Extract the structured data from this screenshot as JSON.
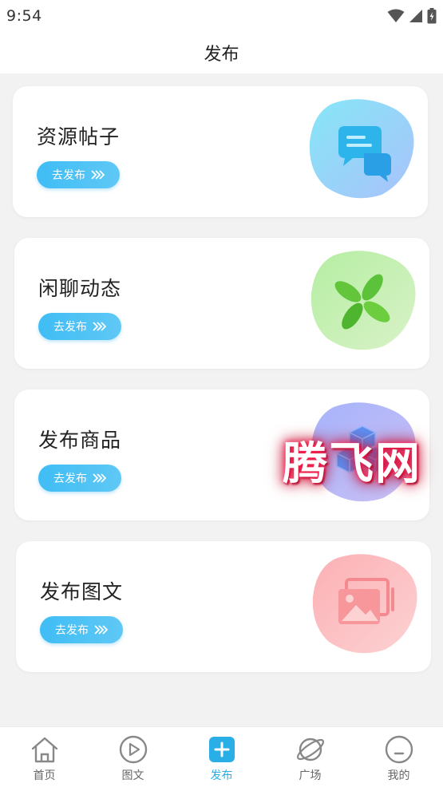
{
  "status": {
    "time": "9:54"
  },
  "header": {
    "title": "发布"
  },
  "cards": [
    {
      "title": "资源帖子",
      "button": "去发布",
      "icon": "chat-bubbles-icon",
      "color_a": "#7fe0f5",
      "color_b": "#a8c8fb"
    },
    {
      "title": "闲聊动态",
      "button": "去发布",
      "icon": "pinwheel-icon",
      "color_a": "#b8efa8",
      "color_b": "#d7f0c4"
    },
    {
      "title": "发布商品",
      "button": "去发布",
      "icon": "cubes-icon",
      "color_a": "#a9b6fb",
      "color_b": "#c8bff7"
    },
    {
      "title": "发布图文",
      "button": "去发布",
      "icon": "photo-album-icon",
      "color_a": "#fbb2b5",
      "color_b": "#fdd0d0"
    }
  ],
  "watermark": {
    "text": "腾飞网"
  },
  "tabs": [
    {
      "label": "首页",
      "icon": "home-icon"
    },
    {
      "label": "图文",
      "icon": "play-circle-icon"
    },
    {
      "label": "发布",
      "icon": "plus-square-icon",
      "active": true
    },
    {
      "label": "广场",
      "icon": "planet-icon"
    },
    {
      "label": "我的",
      "icon": "smile-face-icon"
    }
  ],
  "colors": {
    "accent": "#29aee6",
    "button": "#3fbdf5"
  }
}
